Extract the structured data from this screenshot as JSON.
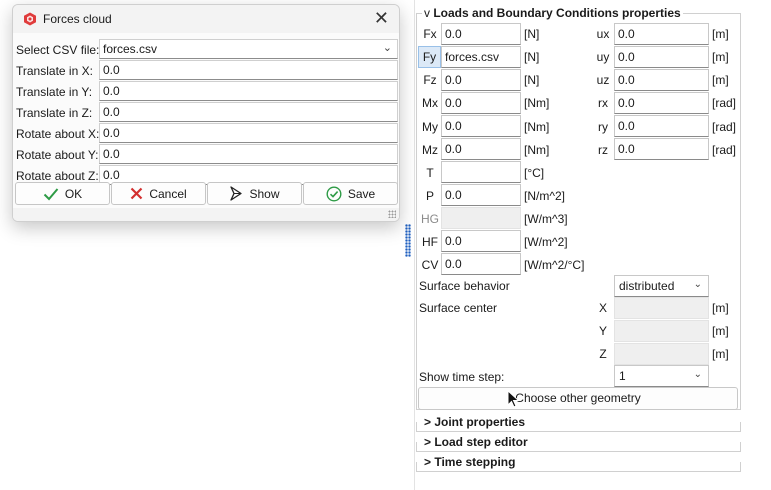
{
  "colors": {
    "accent": "#1f5fbf",
    "ok_green": "#2e9b46",
    "cancel_red": "#d32f2f",
    "app_red": "#e03b3b"
  },
  "dialog": {
    "title": "Forces cloud",
    "app_icon": "app-logo-icon",
    "close_icon": "close-icon",
    "rows": [
      {
        "label": "Select CSV file:",
        "value": "forces.csv",
        "type": "select"
      },
      {
        "label": "Translate in X:",
        "value": "0.0"
      },
      {
        "label": "Translate in Y:",
        "value": "0.0"
      },
      {
        "label": "Translate in Z:",
        "value": "0.0"
      },
      {
        "label": "Rotate about X:",
        "value": "0.0"
      },
      {
        "label": "Rotate about Y:",
        "value": "0.0"
      },
      {
        "label": "Rotate about Z:",
        "value": "0.0"
      }
    ],
    "buttons": {
      "ok": "OK",
      "cancel": "Cancel",
      "show": "Show",
      "save": "Save"
    }
  },
  "panel": {
    "loads_header": "Loads and Boundary Conditions properties",
    "loads_chevron": "v",
    "forces": [
      {
        "label": "Fx",
        "value": "0.0",
        "unit": "[N]"
      },
      {
        "label": "Fy",
        "value": "forces.csv",
        "unit": "[N]"
      },
      {
        "label": "Fz",
        "value": "0.0",
        "unit": "[N]"
      },
      {
        "label": "Mx",
        "value": "0.0",
        "unit": "[Nm]"
      },
      {
        "label": "My",
        "value": "0.0",
        "unit": "[Nm]"
      },
      {
        "label": "Mz",
        "value": "0.0",
        "unit": "[Nm]"
      },
      {
        "label": "T",
        "value": "",
        "unit": "[°C]"
      },
      {
        "label": "P",
        "value": "0.0",
        "unit": "[N/m^2]"
      },
      {
        "label": "HG",
        "value": "",
        "unit": "[W/m^3]"
      },
      {
        "label": "HF",
        "value": "0.0",
        "unit": "[W/m^2]"
      },
      {
        "label": "CV",
        "value": "0.0",
        "unit": "[W/m^2/°C]"
      }
    ],
    "displacements": [
      {
        "label": "ux",
        "value": "0.0",
        "unit": "[m]"
      },
      {
        "label": "uy",
        "value": "0.0",
        "unit": "[m]"
      },
      {
        "label": "uz",
        "value": "0.0",
        "unit": "[m]"
      },
      {
        "label": "rx",
        "value": "0.0",
        "unit": "[rad]"
      },
      {
        "label": "ry",
        "value": "0.0",
        "unit": "[rad]"
      },
      {
        "label": "rz",
        "value": "0.0",
        "unit": "[rad]"
      }
    ],
    "surface_behavior_label": "Surface behavior",
    "surface_behavior_value": "distributed",
    "surface_center_label": "Surface center",
    "surface_center": [
      {
        "label": "X",
        "value": "",
        "unit": "[m]"
      },
      {
        "label": "Y",
        "value": "",
        "unit": "[m]"
      },
      {
        "label": "Z",
        "value": "",
        "unit": "[m]"
      }
    ],
    "show_time_step_label": "Show time step:",
    "show_time_step_value": "1",
    "choose_geometry_button": "Choose other geometry",
    "joint_header": "> Joint properties",
    "load_step_header": "> Load step editor",
    "time_stepping_header": "> Time stepping"
  }
}
